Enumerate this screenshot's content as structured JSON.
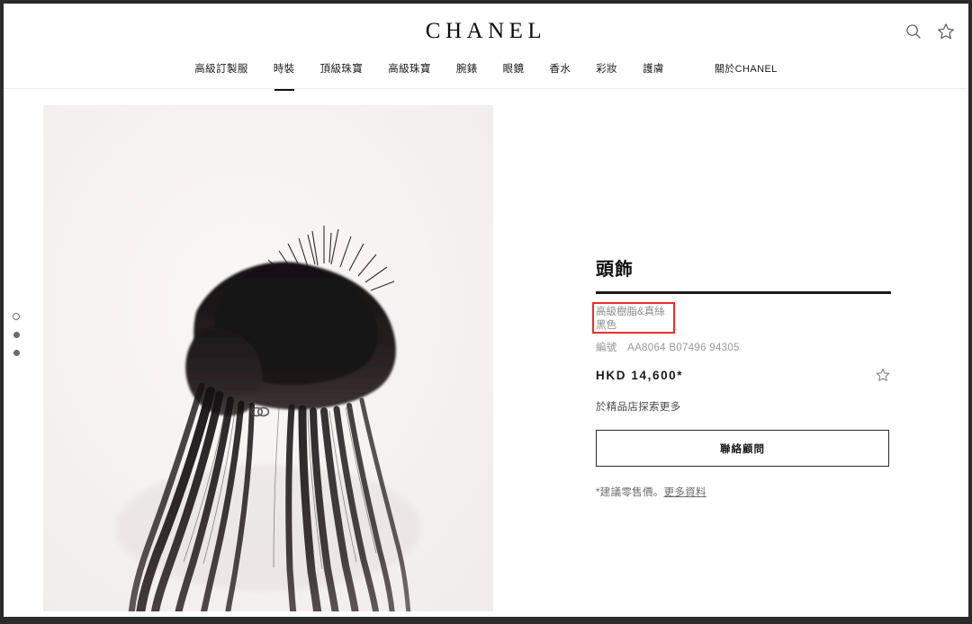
{
  "header": {
    "brand": "CHANEL",
    "tools": [
      {
        "name": "search-icon",
        "label": "Search"
      },
      {
        "name": "wishlist-icon",
        "label": "Wishlist"
      }
    ]
  },
  "nav": {
    "items": [
      {
        "label": "高級訂製服",
        "active": false
      },
      {
        "label": "時裝",
        "active": true
      },
      {
        "label": "頂級珠寶",
        "active": false
      },
      {
        "label": "高級珠寶",
        "active": false
      },
      {
        "label": "腕錶",
        "active": false
      },
      {
        "label": "眼鏡",
        "active": false
      },
      {
        "label": "香水",
        "active": false
      },
      {
        "label": "彩妝",
        "active": false
      },
      {
        "label": "護膚",
        "active": false
      },
      {
        "label": "關於CHANEL",
        "active": false
      }
    ]
  },
  "gallery": {
    "dots": [
      {
        "state": "outline"
      },
      {
        "state": "filled"
      },
      {
        "state": "filled"
      }
    ],
    "image_alt": "黑色高級樹脂及真絲頭飾"
  },
  "product": {
    "title": "頭飾",
    "material": "高級樹脂&真絲",
    "color": "黑色",
    "code_label": "編號",
    "code_value": "AA8064 B07496 94305",
    "price": "HKD 14,600*",
    "boutique_note": "於精品店探索更多",
    "contact_button": "聯絡顧問",
    "disclaimer_text": "*建議零售價。",
    "disclaimer_link": "更多資料"
  },
  "annotation": {
    "highlight_color": "#ef2d2d",
    "target": "material-color-block"
  }
}
